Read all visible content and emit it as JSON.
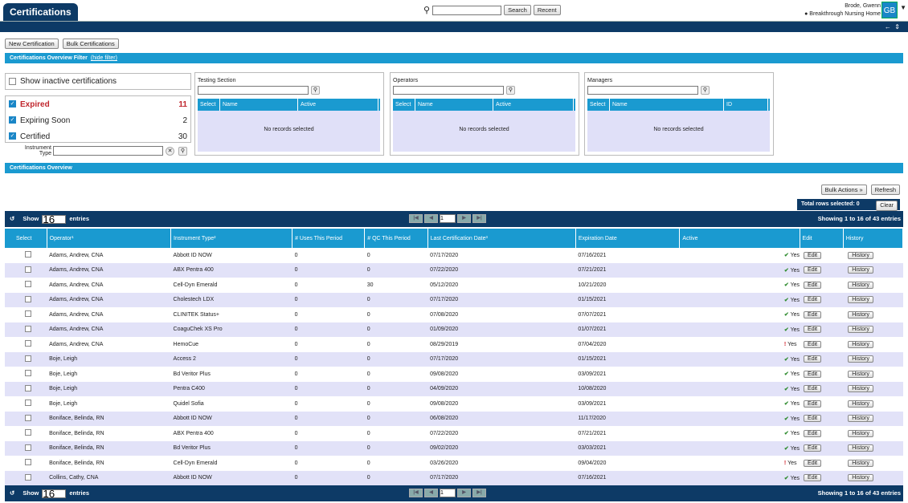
{
  "header": {
    "title": "Certifications",
    "search_button": "Search",
    "recent_button": "Recent",
    "user_name": "Brode, Gwenn",
    "location": "Breakthrough Nursing Home",
    "avatar": "GB"
  },
  "toolbar": {
    "new_cert": "New Certification",
    "bulk_cert": "Bulk Certifications"
  },
  "filter": {
    "title": "Certifications Overview Filter",
    "hide": "(hide filter)",
    "show_inactive": "Show inactive certifications",
    "statuses": [
      {
        "label": "Expired",
        "count": "11"
      },
      {
        "label": "Expiring Soon",
        "count": "2"
      },
      {
        "label": "Certified",
        "count": "30"
      }
    ],
    "instrument_type": "Instrument Type"
  },
  "panels": [
    {
      "title": "Testing Section",
      "cols": [
        "Select",
        "Name",
        "Active"
      ],
      "empty": "No records selected"
    },
    {
      "title": "Operators",
      "cols": [
        "Select",
        "Name",
        "Active"
      ],
      "empty": "No records selected"
    },
    {
      "title": "Managers",
      "cols": [
        "Select",
        "Name",
        "ID"
      ],
      "empty": "No records selected"
    }
  ],
  "overview": {
    "title": "Certifications Overview",
    "bulk_actions": "Bulk Actions",
    "refresh": "Refresh",
    "total_selected": "Total rows selected: 0",
    "clear": "Clear",
    "show": "Show",
    "entries": "entries",
    "show_count": "16",
    "page": "1",
    "showing": "Showing 1 to 16 of 43 entries"
  },
  "columns": [
    "Select",
    "Operator¹",
    "Instrument Type²",
    "# Uses This Period",
    "# QC This Period",
    "Last Certification Date³",
    "Expiration Date",
    "Active",
    "Edit",
    "History"
  ],
  "rows": [
    [
      "Adams, Andrew, CNA",
      "Abbott ID NOW",
      "0",
      "0",
      "07/17/2020",
      "07/16/2021",
      "ok"
    ],
    [
      "Adams, Andrew, CNA",
      "ABX Pentra 400",
      "0",
      "0",
      "07/22/2020",
      "07/21/2021",
      "ok"
    ],
    [
      "Adams, Andrew, CNA",
      "Cell-Dyn Emerald",
      "0",
      "30",
      "05/12/2020",
      "10/21/2020",
      "ok"
    ],
    [
      "Adams, Andrew, CNA",
      "Cholestech LDX",
      "0",
      "0",
      "07/17/2020",
      "01/15/2021",
      "ok"
    ],
    [
      "Adams, Andrew, CNA",
      "CLINITEK Status+",
      "0",
      "0",
      "07/08/2020",
      "07/07/2021",
      "ok"
    ],
    [
      "Adams, Andrew, CNA",
      "CoaguChek XS Pro",
      "0",
      "0",
      "01/09/2020",
      "01/07/2021",
      "ok"
    ],
    [
      "Adams, Andrew, CNA",
      "HemoCue",
      "0",
      "0",
      "08/29/2019",
      "07/04/2020",
      "bad"
    ],
    [
      "Boje, Leigh",
      "Access 2",
      "0",
      "0",
      "07/17/2020",
      "01/15/2021",
      "ok"
    ],
    [
      "Boje, Leigh",
      "Bd Veritor Plus",
      "0",
      "0",
      "09/08/2020",
      "03/09/2021",
      "ok"
    ],
    [
      "Boje, Leigh",
      "Pentra C400",
      "0",
      "0",
      "04/09/2020",
      "10/08/2020",
      "ok"
    ],
    [
      "Boje, Leigh",
      "Quidel Sofia",
      "0",
      "0",
      "09/08/2020",
      "03/09/2021",
      "ok"
    ],
    [
      "Boniface, Belinda, RN",
      "Abbott ID NOW",
      "0",
      "0",
      "06/08/2020",
      "11/17/2020",
      "ok"
    ],
    [
      "Boniface, Belinda, RN",
      "ABX Pentra 400",
      "0",
      "0",
      "07/22/2020",
      "07/21/2021",
      "ok"
    ],
    [
      "Boniface, Belinda, RN",
      "Bd Veritor Plus",
      "0",
      "0",
      "09/02/2020",
      "03/03/2021",
      "ok"
    ],
    [
      "Boniface, Belinda, RN",
      "Cell-Dyn Emerald",
      "0",
      "0",
      "03/26/2020",
      "09/04/2020",
      "bad"
    ],
    [
      "Collins, Cathy, CNA",
      "Abbott ID NOW",
      "0",
      "0",
      "07/17/2020",
      "07/16/2021",
      "ok"
    ]
  ],
  "yes": "Yes",
  "edit": "Edit",
  "history": "History"
}
